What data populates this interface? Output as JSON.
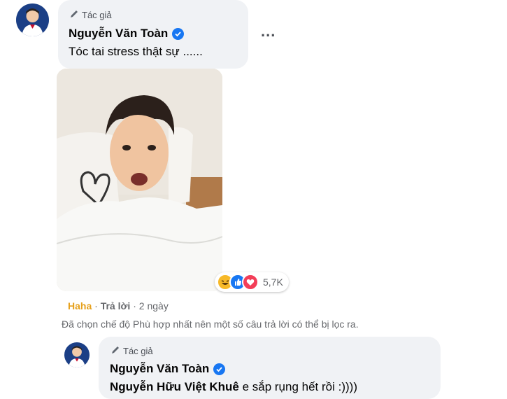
{
  "comment1": {
    "author_tag": "Tác giả",
    "author_name": "Nguyễn Văn Toàn",
    "text": "Tóc tai stress thật sự ......",
    "more_label": "...",
    "reactions": {
      "icons": [
        "haha-icon",
        "like-icon",
        "love-icon"
      ],
      "count": "5,7K"
    },
    "actions": {
      "reaction": "Haha",
      "separator": " · ",
      "reply": "Trả lời",
      "time": "2 ngày"
    }
  },
  "filter_note": "Đã chọn chế độ Phù hợp nhất nên một số câu trả lời có thể bị lọc ra.",
  "reply1": {
    "author_tag": "Tác giả",
    "author_name": "Nguyễn Văn Toàn",
    "mention": "Nguyễn Hữu Việt Khuê",
    "text": " e sắp rụng hết rồi :))))"
  },
  "colors": {
    "bubble": "#f0f2f5",
    "verified": "#1877f2",
    "haha": "#e6a01b",
    "meta": "#65676b"
  }
}
